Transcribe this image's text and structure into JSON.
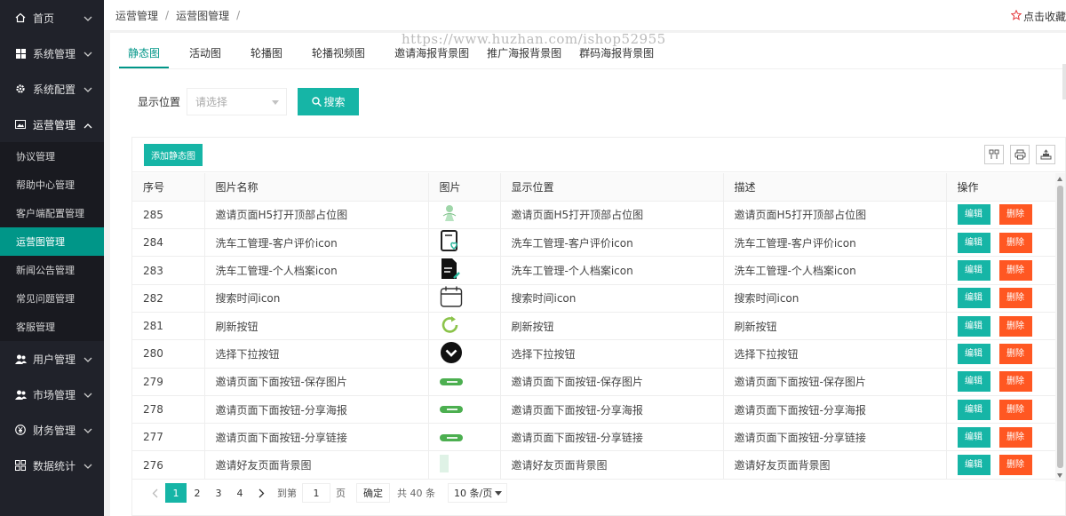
{
  "sidebar": {
    "items": [
      {
        "label": "首页",
        "icon": "home-icon"
      },
      {
        "label": "系统管理",
        "icon": "windows-icon"
      },
      {
        "label": "系统配置",
        "icon": "gear-icon"
      },
      {
        "label": "运营管理",
        "icon": "image-icon"
      }
    ],
    "sub_items": [
      "协议管理",
      "帮助中心管理",
      "客户端配置管理",
      "运营图管理",
      "新闻公告管理",
      "常见问题管理",
      "客服管理"
    ],
    "active_sub": "运营图管理",
    "bottom_items": [
      {
        "label": "用户管理",
        "icon": "users-icon"
      },
      {
        "label": "市场管理",
        "icon": "users-icon"
      },
      {
        "label": "财务管理",
        "icon": "yen-icon"
      },
      {
        "label": "数据统计",
        "icon": "grid-icon"
      }
    ]
  },
  "breadcrumb": {
    "level1": "运营管理",
    "level2": "运营图管理",
    "separator": "/"
  },
  "favorite_label": "点击收藏",
  "watermark": "https://www.huzhan.com/ishop52955",
  "tabs": [
    "静态图",
    "活动图",
    "轮播图",
    "轮播视频图",
    "邀请海报背景图",
    "推广海报背景图",
    "群码海报背景图"
  ],
  "filter": {
    "label": "显示位置",
    "placeholder": "请选择",
    "search_label": "搜索"
  },
  "toolbar": {
    "add_label": "添加静态图"
  },
  "table": {
    "headers": [
      "序号",
      "图片名称",
      "图片",
      "显示位置",
      "描述",
      "操作"
    ],
    "edit_label": "编辑",
    "delete_label": "删除",
    "rows": [
      {
        "id": "285",
        "name": "邀请页面H5打开顶部占位图",
        "thumb": "figure-thumb",
        "position": "邀请页面H5打开顶部占位图",
        "desc": "邀请页面H5打开顶部占位图"
      },
      {
        "id": "284",
        "name": "洗车工管理-客户评价icon",
        "thumb": "review-doc-icon",
        "position": "洗车工管理-客户评价icon",
        "desc": "洗车工管理-客户评价icon"
      },
      {
        "id": "283",
        "name": "洗车工管理-个人档案icon",
        "thumb": "profile-doc-icon",
        "position": "洗车工管理-个人档案icon",
        "desc": "洗车工管理-个人档案icon"
      },
      {
        "id": "282",
        "name": "搜索时间icon",
        "thumb": "calendar-icon",
        "position": "搜索时间icon",
        "desc": "搜索时间icon"
      },
      {
        "id": "281",
        "name": "刷新按钮",
        "thumb": "refresh-icon",
        "position": "刷新按钮",
        "desc": "刷新按钮"
      },
      {
        "id": "280",
        "name": "选择下拉按钮",
        "thumb": "dropdown-circle-icon",
        "position": "选择下拉按钮",
        "desc": "选择下拉按钮"
      },
      {
        "id": "279",
        "name": "邀请页面下面按钮-保存图片",
        "thumb": "green-pill-button",
        "position": "邀请页面下面按钮-保存图片",
        "desc": "邀请页面下面按钮-保存图片"
      },
      {
        "id": "278",
        "name": "邀请页面下面按钮-分享海报",
        "thumb": "green-pill-button",
        "position": "邀请页面下面按钮-分享海报",
        "desc": "邀请页面下面按钮-分享海报"
      },
      {
        "id": "277",
        "name": "邀请页面下面按钮-分享链接",
        "thumb": "green-pill-button",
        "position": "邀请页面下面按钮-分享链接",
        "desc": "邀请页面下面按钮-分享链接"
      },
      {
        "id": "276",
        "name": "邀请好友页面背景图",
        "thumb": "background-thumb",
        "position": "邀请好友页面背景图",
        "desc": "邀请好友页面背景图"
      }
    ]
  },
  "pagination": {
    "pages": [
      "1",
      "2",
      "3",
      "4"
    ],
    "current": "1",
    "goto_prefix": "到第",
    "goto_value": "1",
    "goto_suffix": "页",
    "confirm_label": "确定",
    "total_label": "共 40 条",
    "page_size_label": "10 条/页"
  },
  "colors": {
    "accent": "#16b5a6",
    "danger": "#ff5722",
    "sidebar_bg": "#20222a",
    "active_sub": "#009688"
  }
}
